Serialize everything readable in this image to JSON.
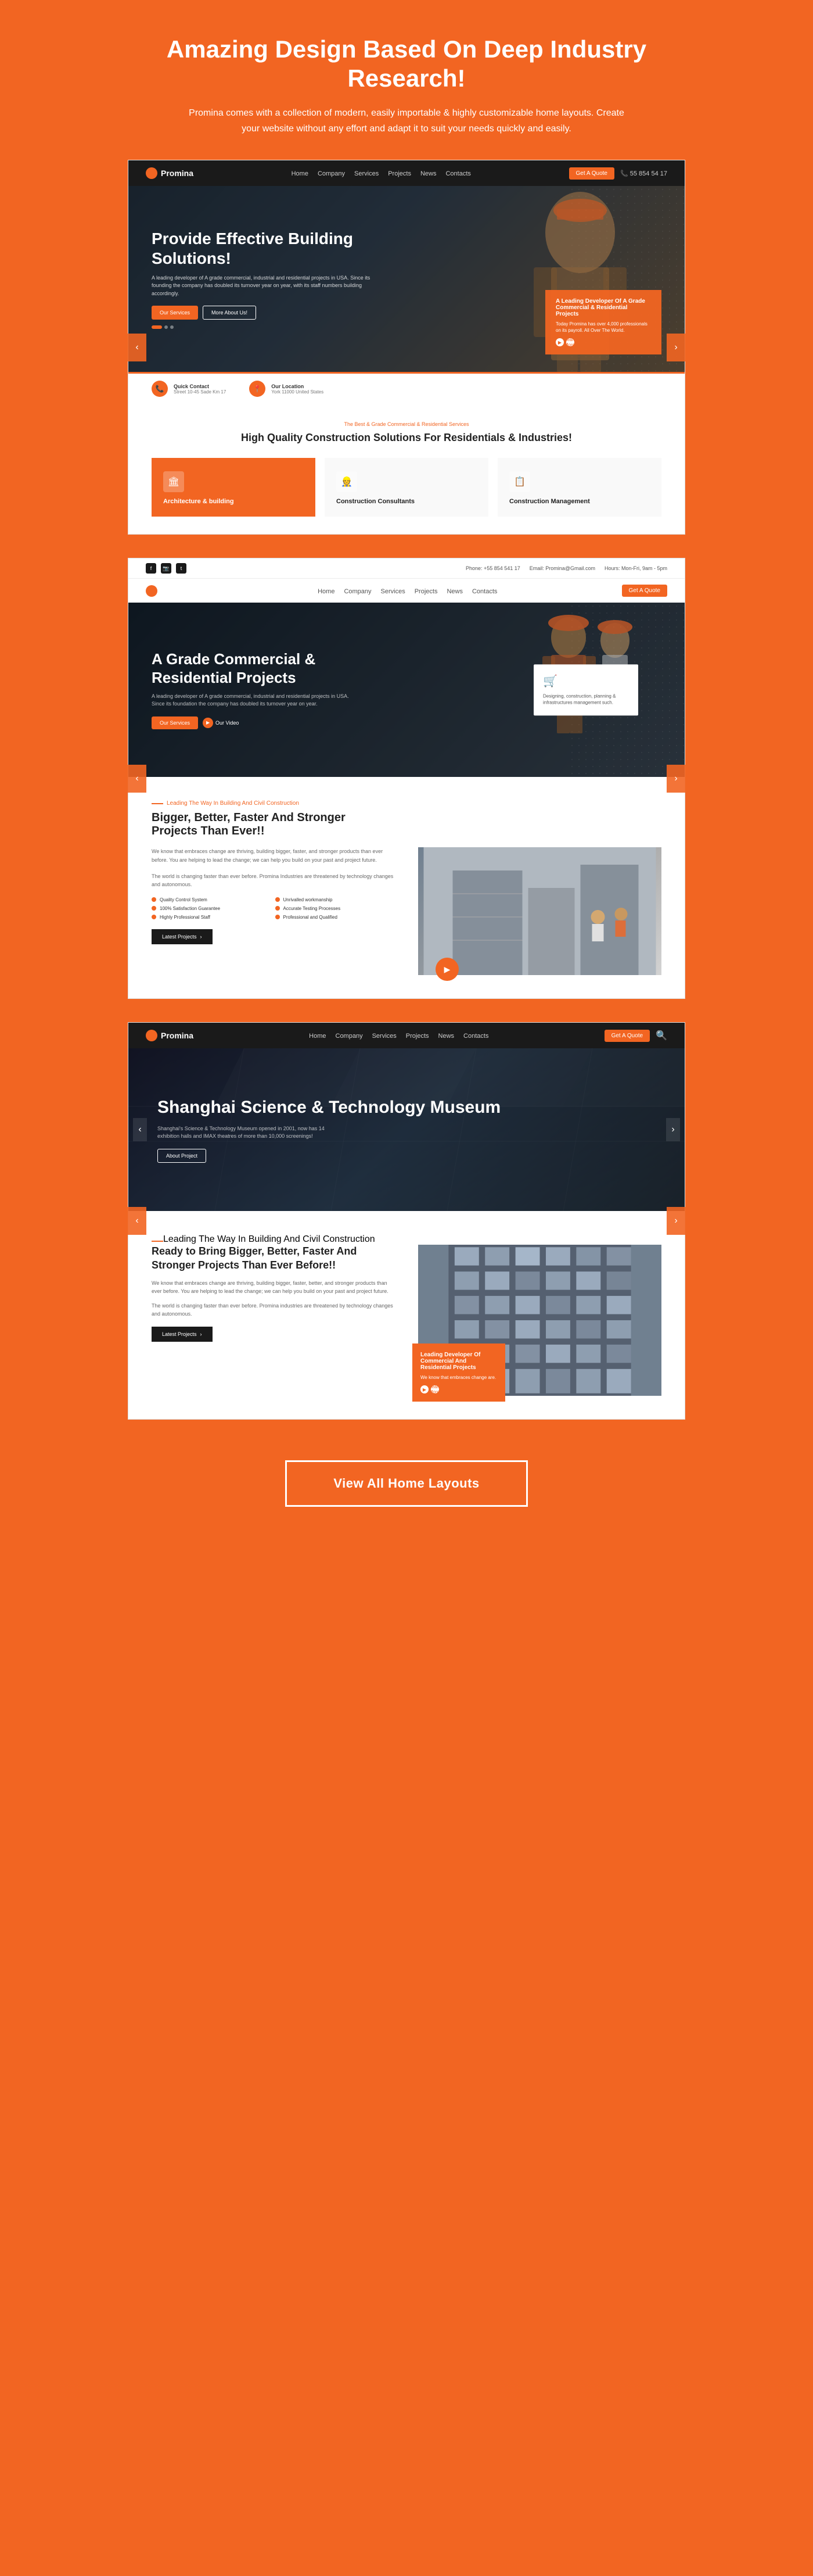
{
  "hero_header": {
    "title": "Amazing Design Based On Deep Industry Research!",
    "description": "Promina comes with a collection of modern, easily importable & highly customizable home layouts. Create your website without any effort and adapt it to suit your needs quickly and easily."
  },
  "layout1": {
    "nav": {
      "logo": "Promina",
      "links": [
        "Home",
        "Company",
        "Services",
        "Projects",
        "News",
        "Contacts"
      ],
      "cta": "Get A Quote",
      "phone": "55 854 54 17"
    },
    "hero": {
      "title": "Provide Effective Building Solutions!",
      "description": "A leading developer of A grade commercial, industrial and residential projects in USA. Since its founding the company has doubled its turnover year on year, with its staff numbers building accordingly.",
      "btn1": "Our Services",
      "btn2": "More About Us!",
      "card_title": "A Leading Developer Of A Grade Commercial & Residential Projects",
      "card_desc": "Today Promina has over 4,000 professionals on its payroll. All Over The World.",
      "learn_more": "Learn More"
    },
    "info": {
      "item1_title": "Quick Contact",
      "item1_desc": "Street 10-45 Sade Km 17",
      "item2_title": "Our Location",
      "item2_desc": "York 11000 United States"
    },
    "services": {
      "tag": "The Best & Grade Commercial & Residential Services",
      "title": "High Quality Construction Solutions For Residentials & Industries!",
      "items": [
        {
          "name": "Architecture & building",
          "active": true
        },
        {
          "name": "Construction Consultants",
          "active": false
        },
        {
          "name": "Construction Management",
          "active": false
        }
      ]
    }
  },
  "layout2": {
    "top_bar": {
      "social": [
        "f",
        "📷",
        "t"
      ],
      "phone": "Phone: +55 854 541 17",
      "email": "Email: Promina@Gmail.com",
      "hours": "Hours: Mon-Fri, 9am - 5pm"
    },
    "hero": {
      "title": "A Grade Commercial & Residential Projects",
      "description": "A leading developer of A grade commercial, industrial and residential projects in USA. Since its foundation the company has doubled its turnover year on year.",
      "btn1": "Our Services",
      "btn2": "Our Video",
      "side_card_desc": "Designing, construction, planning & infrastructures management such."
    }
  },
  "middle_section": {
    "lead_tag": "Leading The Way In Building And Civil Construction",
    "title": "Bigger, Better, Faster And Stronger Projects Than Ever!!",
    "description1": "We know that embraces change are thriving, building bigger, faster, and stronger products than ever before. You are helping to lead the change; we can help you build on your past and project future.",
    "description2": "The world is changing faster than ever before. Promina Industries are threatened by technology changes and autonomous.",
    "features": [
      "Quality Control System",
      "100% Satisfaction Guarantee",
      "Highly Professional Staff",
      "Unrivalled workmanship",
      "Accurate Testing Processes",
      "Professional and Qualified"
    ],
    "btn": "Latest Projects"
  },
  "layout3": {
    "nav": {
      "logo": "Promina",
      "links": [
        "Home",
        "Company",
        "Services",
        "Projects",
        "News",
        "Contacts"
      ],
      "cta": "Get A Quote"
    },
    "hero": {
      "title": "Shanghai Science & Technology Museum",
      "description": "Shanghai's Science & Technology Museum opened in 2001, now has 14 exhibition halls and IMAX theatres of more than 10,000 screenings!",
      "btn": "About Project"
    }
  },
  "layout4": {
    "lead_tag": "Leading The Way In Building And Civil Construction",
    "title": "Ready to Bring Bigger, Better, Faster And Stronger Projects Than Ever Before!!",
    "description1": "We know that embraces change are thriving, building bigger, faster, better, and stronger products than ever before. You are helping to lead the change; we can help you build on your past and project future.",
    "description2": "The world is changing faster than ever before. Promina industries are threatened by technology changes and autonomous.",
    "btn": "Latest Projects",
    "card": {
      "title": "Leading Developer Of Commercial And Residential Projects",
      "desc": "We know that embraces change are.",
      "learn_more": "Learn More"
    }
  },
  "cta": {
    "btn_label": "View All Home Layouts"
  }
}
